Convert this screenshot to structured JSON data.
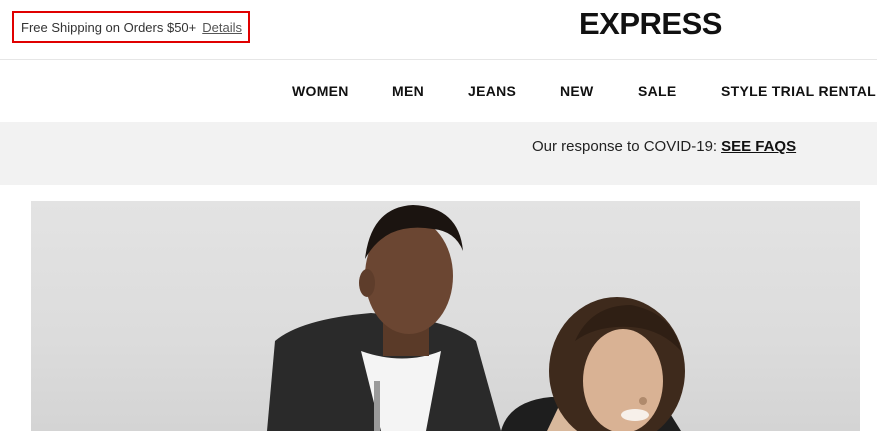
{
  "promo": {
    "text": "Free Shipping on Orders $50+",
    "details_label": "Details",
    "outline_color": "#e00000"
  },
  "brand": {
    "logo_text": "EXPRESS"
  },
  "nav": {
    "items": [
      {
        "label": "WOMEN"
      },
      {
        "label": "MEN"
      },
      {
        "label": "JEANS"
      },
      {
        "label": "NEW"
      },
      {
        "label": "SALE"
      },
      {
        "label": "STYLE TRIAL RENTAL"
      }
    ]
  },
  "covid_banner": {
    "text": "Our response to COVID-19:",
    "link_label": "SEE FAQS"
  },
  "hero": {
    "image_kind": "photo of two models"
  }
}
